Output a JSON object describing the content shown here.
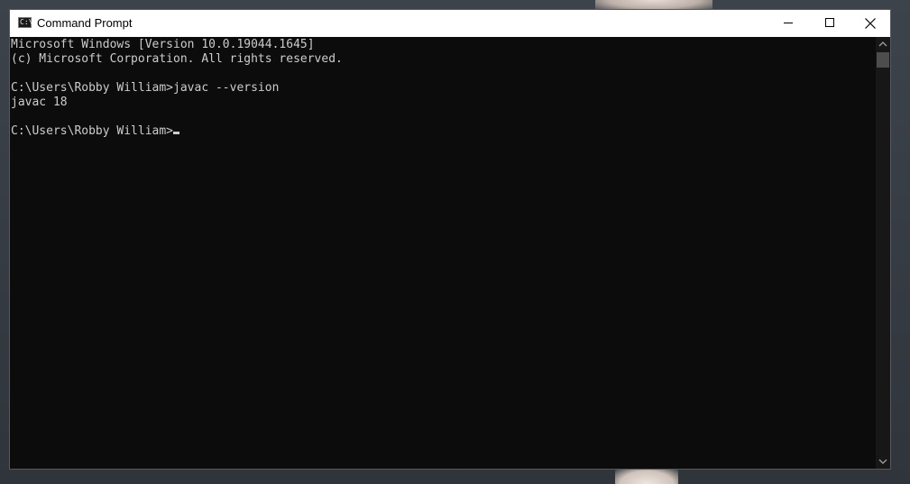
{
  "window": {
    "title": "Command Prompt",
    "icon": "cmd-prompt-icon",
    "icon_glyph": "C:\\",
    "controls": {
      "minimize": "minimize-icon",
      "maximize": "maximize-icon",
      "close": "close-icon"
    }
  },
  "console": {
    "lines": [
      "Microsoft Windows [Version 10.0.19044.1645]",
      "(c) Microsoft Corporation. All rights reserved.",
      "",
      "C:\\Users\\Robby William>javac --version",
      "javac 18",
      "",
      "C:\\Users\\Robby William>"
    ],
    "text_color": "#cccccc",
    "background_color": "#0c0c0c"
  },
  "scrollbar": {
    "up_icon": "chevron-up-icon",
    "down_icon": "chevron-down-icon"
  }
}
